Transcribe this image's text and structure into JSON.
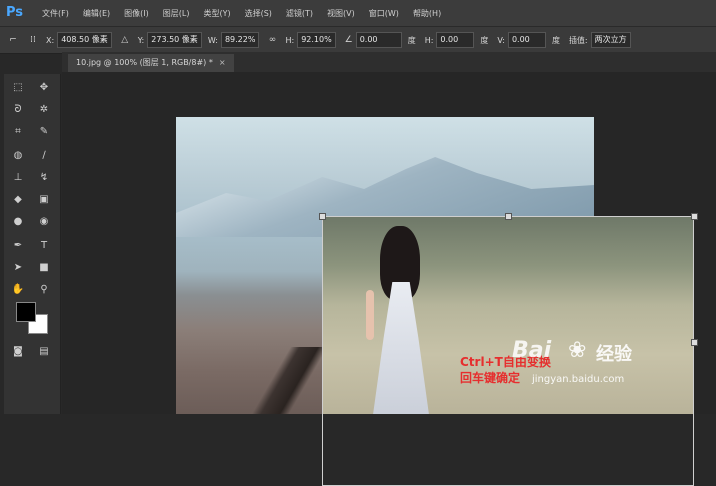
{
  "app": {
    "logo": "Ps"
  },
  "menu": [
    "文件(F)",
    "编辑(E)",
    "图像(I)",
    "图层(L)",
    "类型(Y)",
    "选择(S)",
    "滤镜(T)",
    "视图(V)",
    "窗口(W)",
    "帮助(H)"
  ],
  "options": {
    "x_label": "X:",
    "x_value": "408.50 像素",
    "y_label": "Y:",
    "y_value": "273.50 像素",
    "w_label": "W:",
    "w_value": "89.22%",
    "h_label": "H:",
    "h_value": "92.10%",
    "angle_value": "0.00",
    "angle_unit": "度",
    "hskew_label": "H:",
    "hskew_value": "0.00",
    "hskew_unit": "度",
    "vskew_label": "V:",
    "vskew_value": "0.00",
    "vskew_unit": "度",
    "interp_label": "插值:",
    "interp_value": "两次立方"
  },
  "document_tab": {
    "title": "10.jpg @ 100% (图层 1, RGB/8#) *",
    "close": "×"
  },
  "caption": {
    "line1": "Ctrl+T自由变换",
    "line2": "回车键确定"
  },
  "watermark": {
    "logo": "Bai",
    "text": "经验",
    "url": "jingyan.baidu.com"
  },
  "colors": {
    "accent": "#4aa8ff",
    "caption": "#e62e2e"
  },
  "icons": {
    "move": "move-icon",
    "marquee": "marquee-icon",
    "lasso": "lasso-icon",
    "wand": "magic-wand-icon",
    "crop": "crop-icon",
    "eyedropper": "eyedropper-icon",
    "heal": "heal-icon",
    "brush": "brush-icon",
    "stamp": "stamp-icon",
    "history": "history-brush-icon",
    "eraser": "eraser-icon",
    "gradient": "gradient-icon",
    "blur": "blur-icon",
    "dodge": "dodge-icon",
    "pen": "pen-icon",
    "type": "type-icon",
    "path": "path-select-icon",
    "shape": "shape-icon",
    "hand": "hand-icon",
    "zoom": "zoom-icon"
  }
}
